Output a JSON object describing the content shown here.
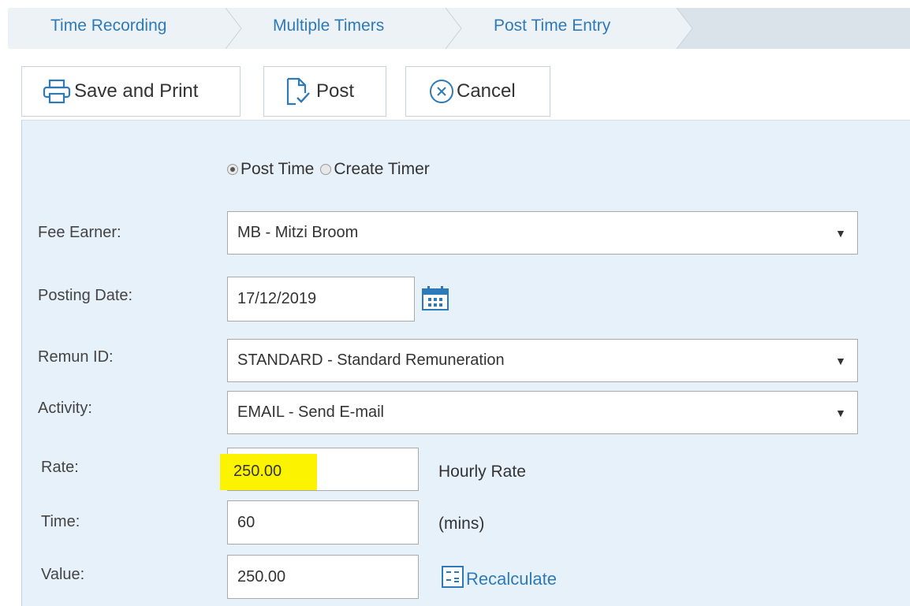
{
  "breadcrumb": {
    "items": [
      "Time Recording",
      "Multiple Timers",
      "Post Time Entry"
    ]
  },
  "toolbar": {
    "save_print_label": "Save and Print",
    "post_label": "Post",
    "cancel_label": "Cancel"
  },
  "mode": {
    "options": [
      "Post Time",
      "Create Timer"
    ],
    "selected": "Post Time"
  },
  "form": {
    "fee_earner": {
      "label": "Fee Earner:",
      "value": "MB - Mitzi Broom"
    },
    "posting_date": {
      "label": "Posting Date:",
      "value": "17/12/2019"
    },
    "remun_id": {
      "label": "Remun ID:",
      "value": "STANDARD - Standard Remuneration"
    },
    "activity": {
      "label": "Activity:",
      "value": "EMAIL - Send E-mail"
    },
    "rate": {
      "label": "Rate:",
      "value": "250.00",
      "suffix": "Hourly Rate"
    },
    "time": {
      "label": "Time:",
      "value": "60",
      "suffix": "(mins)"
    },
    "value": {
      "label": "Value:",
      "value": "250.00"
    },
    "recalculate_label": "Recalculate"
  },
  "icons": {
    "dropdown": "triangle-down-icon",
    "calendar": "calendar-icon",
    "printer": "printer-icon",
    "post": "document-check-icon",
    "cancel": "circle-x-icon",
    "recalculate": "calculator-icon"
  },
  "colors": {
    "link_blue": "#2e7ab8",
    "panel_bg": "#e7f1fa",
    "highlight": "#fcf300"
  }
}
